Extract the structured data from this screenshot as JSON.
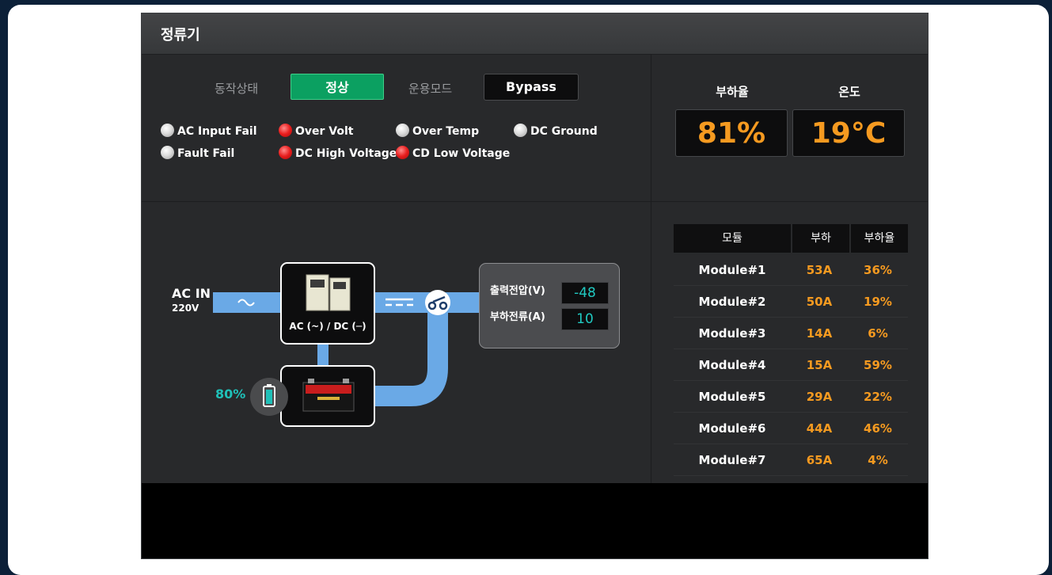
{
  "panel": {
    "title": "정류기"
  },
  "status": {
    "op_state_label": "동작상태",
    "op_state_value": "정상",
    "mode_label": "운용모드",
    "mode_value": "Bypass",
    "alarms": [
      {
        "label": "AC Input Fail",
        "color": "white"
      },
      {
        "label": "Over Volt",
        "color": "red"
      },
      {
        "label": "Over Temp",
        "color": "white"
      },
      {
        "label": "DC Ground",
        "color": "white"
      },
      {
        "label": "Fault Fail",
        "color": "white"
      },
      {
        "label": "DC High Voltage",
        "color": "red"
      },
      {
        "label": "CD Low Voltage",
        "color": "red"
      }
    ]
  },
  "gauges": {
    "load_label": "부하율",
    "load_value": "81%",
    "temp_label": "온도",
    "temp_value": "19°C"
  },
  "diagram": {
    "ac_in_label": "AC IN",
    "ac_in_voltage": "220V",
    "rectifier_label": "AC (~) / DC (─)",
    "battery_percent": "80%",
    "output_voltage_label": "출력전압(V)",
    "output_voltage_value": "-48",
    "load_current_label": "부하전류(A)",
    "load_current_value": "10"
  },
  "modules": {
    "headers": [
      "모듈",
      "부하",
      "부하율"
    ],
    "rows": [
      {
        "name": "Module#1",
        "load": "53A",
        "rate": "36%"
      },
      {
        "name": "Module#2",
        "load": "50A",
        "rate": "19%"
      },
      {
        "name": "Module#3",
        "load": "14A",
        "rate": "6%"
      },
      {
        "name": "Module#4",
        "load": "15A",
        "rate": "59%"
      },
      {
        "name": "Module#5",
        "load": "29A",
        "rate": "22%"
      },
      {
        "name": "Module#6",
        "load": "44A",
        "rate": "46%"
      },
      {
        "name": "Module#7",
        "load": "65A",
        "rate": "4%"
      }
    ]
  },
  "colors": {
    "accent_orange": "#f59a20",
    "status_green": "#0ba061",
    "teal": "#1fc0b8",
    "pipe_blue": "#6aa9e6"
  }
}
